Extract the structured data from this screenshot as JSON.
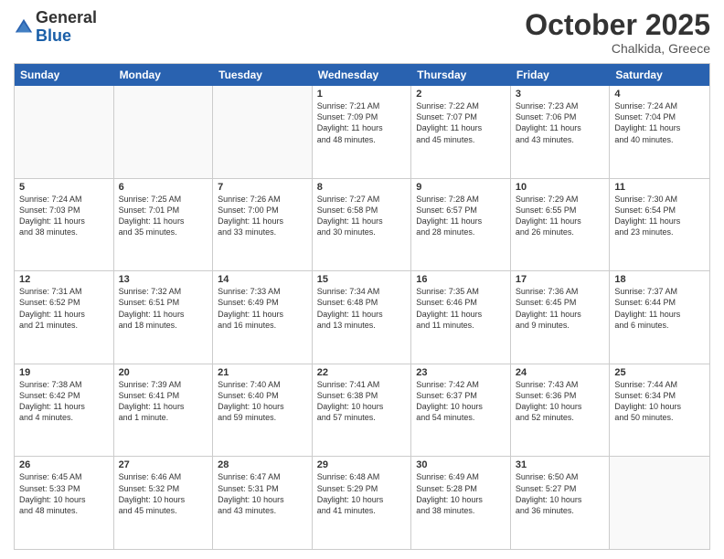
{
  "header": {
    "logo_general": "General",
    "logo_blue": "Blue",
    "month_title": "October 2025",
    "location": "Chalkida, Greece"
  },
  "day_headers": [
    "Sunday",
    "Monday",
    "Tuesday",
    "Wednesday",
    "Thursday",
    "Friday",
    "Saturday"
  ],
  "weeks": [
    [
      {
        "num": "",
        "info": "",
        "empty": true
      },
      {
        "num": "",
        "info": "",
        "empty": true
      },
      {
        "num": "",
        "info": "",
        "empty": true
      },
      {
        "num": "1",
        "info": "Sunrise: 7:21 AM\nSunset: 7:09 PM\nDaylight: 11 hours\nand 48 minutes."
      },
      {
        "num": "2",
        "info": "Sunrise: 7:22 AM\nSunset: 7:07 PM\nDaylight: 11 hours\nand 45 minutes."
      },
      {
        "num": "3",
        "info": "Sunrise: 7:23 AM\nSunset: 7:06 PM\nDaylight: 11 hours\nand 43 minutes."
      },
      {
        "num": "4",
        "info": "Sunrise: 7:24 AM\nSunset: 7:04 PM\nDaylight: 11 hours\nand 40 minutes."
      }
    ],
    [
      {
        "num": "5",
        "info": "Sunrise: 7:24 AM\nSunset: 7:03 PM\nDaylight: 11 hours\nand 38 minutes."
      },
      {
        "num": "6",
        "info": "Sunrise: 7:25 AM\nSunset: 7:01 PM\nDaylight: 11 hours\nand 35 minutes."
      },
      {
        "num": "7",
        "info": "Sunrise: 7:26 AM\nSunset: 7:00 PM\nDaylight: 11 hours\nand 33 minutes."
      },
      {
        "num": "8",
        "info": "Sunrise: 7:27 AM\nSunset: 6:58 PM\nDaylight: 11 hours\nand 30 minutes."
      },
      {
        "num": "9",
        "info": "Sunrise: 7:28 AM\nSunset: 6:57 PM\nDaylight: 11 hours\nand 28 minutes."
      },
      {
        "num": "10",
        "info": "Sunrise: 7:29 AM\nSunset: 6:55 PM\nDaylight: 11 hours\nand 26 minutes."
      },
      {
        "num": "11",
        "info": "Sunrise: 7:30 AM\nSunset: 6:54 PM\nDaylight: 11 hours\nand 23 minutes."
      }
    ],
    [
      {
        "num": "12",
        "info": "Sunrise: 7:31 AM\nSunset: 6:52 PM\nDaylight: 11 hours\nand 21 minutes."
      },
      {
        "num": "13",
        "info": "Sunrise: 7:32 AM\nSunset: 6:51 PM\nDaylight: 11 hours\nand 18 minutes."
      },
      {
        "num": "14",
        "info": "Sunrise: 7:33 AM\nSunset: 6:49 PM\nDaylight: 11 hours\nand 16 minutes."
      },
      {
        "num": "15",
        "info": "Sunrise: 7:34 AM\nSunset: 6:48 PM\nDaylight: 11 hours\nand 13 minutes."
      },
      {
        "num": "16",
        "info": "Sunrise: 7:35 AM\nSunset: 6:46 PM\nDaylight: 11 hours\nand 11 minutes."
      },
      {
        "num": "17",
        "info": "Sunrise: 7:36 AM\nSunset: 6:45 PM\nDaylight: 11 hours\nand 9 minutes."
      },
      {
        "num": "18",
        "info": "Sunrise: 7:37 AM\nSunset: 6:44 PM\nDaylight: 11 hours\nand 6 minutes."
      }
    ],
    [
      {
        "num": "19",
        "info": "Sunrise: 7:38 AM\nSunset: 6:42 PM\nDaylight: 11 hours\nand 4 minutes."
      },
      {
        "num": "20",
        "info": "Sunrise: 7:39 AM\nSunset: 6:41 PM\nDaylight: 11 hours\nand 1 minute."
      },
      {
        "num": "21",
        "info": "Sunrise: 7:40 AM\nSunset: 6:40 PM\nDaylight: 10 hours\nand 59 minutes."
      },
      {
        "num": "22",
        "info": "Sunrise: 7:41 AM\nSunset: 6:38 PM\nDaylight: 10 hours\nand 57 minutes."
      },
      {
        "num": "23",
        "info": "Sunrise: 7:42 AM\nSunset: 6:37 PM\nDaylight: 10 hours\nand 54 minutes."
      },
      {
        "num": "24",
        "info": "Sunrise: 7:43 AM\nSunset: 6:36 PM\nDaylight: 10 hours\nand 52 minutes."
      },
      {
        "num": "25",
        "info": "Sunrise: 7:44 AM\nSunset: 6:34 PM\nDaylight: 10 hours\nand 50 minutes."
      }
    ],
    [
      {
        "num": "26",
        "info": "Sunrise: 6:45 AM\nSunset: 5:33 PM\nDaylight: 10 hours\nand 48 minutes."
      },
      {
        "num": "27",
        "info": "Sunrise: 6:46 AM\nSunset: 5:32 PM\nDaylight: 10 hours\nand 45 minutes."
      },
      {
        "num": "28",
        "info": "Sunrise: 6:47 AM\nSunset: 5:31 PM\nDaylight: 10 hours\nand 43 minutes."
      },
      {
        "num": "29",
        "info": "Sunrise: 6:48 AM\nSunset: 5:29 PM\nDaylight: 10 hours\nand 41 minutes."
      },
      {
        "num": "30",
        "info": "Sunrise: 6:49 AM\nSunset: 5:28 PM\nDaylight: 10 hours\nand 38 minutes."
      },
      {
        "num": "31",
        "info": "Sunrise: 6:50 AM\nSunset: 5:27 PM\nDaylight: 10 hours\nand 36 minutes."
      },
      {
        "num": "",
        "info": "",
        "empty": true
      }
    ]
  ]
}
